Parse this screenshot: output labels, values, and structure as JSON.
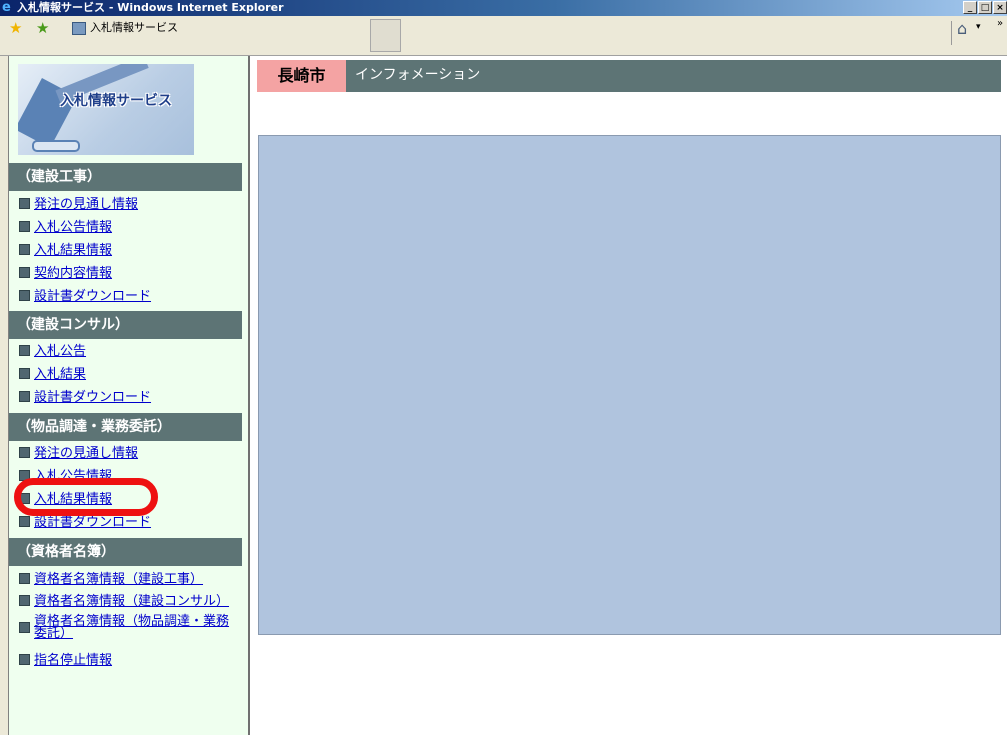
{
  "window": {
    "title": "入札情報サービス - Windows Internet Explorer",
    "min_label": "_",
    "max_label": "□",
    "close_label": "×"
  },
  "toolbar": {
    "tab_title": "入札情報サービス",
    "home_dropdown": "▾",
    "more_label": "»"
  },
  "logo": {
    "text": "入札情報サービス"
  },
  "sections": [
    {
      "header": "（建設工事）",
      "items": [
        "発注の見通し情報",
        "入札公告情報",
        "入札結果情報",
        "契約内容情報",
        "設計書ダウンロード"
      ]
    },
    {
      "header": "（建設コンサル）",
      "items": [
        "入札公告",
        "入札結果",
        "設計書ダウンロード"
      ]
    },
    {
      "header": "（物品調達・業務委託）",
      "items": [
        "発注の見通し情報",
        "入札公告情報",
        "入札結果情報",
        "設計書ダウンロード"
      ]
    },
    {
      "header": "（資格者名簿）",
      "items": [
        "資格者名簿情報（建設工事）",
        "資格者名簿情報（建設コンサル）",
        "資格者名簿情報（物品調達・業務委託）",
        "指名停止情報"
      ]
    }
  ],
  "main": {
    "city": "長崎市",
    "info_label": "インフォメーション"
  },
  "colors": {
    "section_header_bg": "#5d7475",
    "sidebar_bg": "#efffef",
    "city_badge_bg": "#f4a3a3",
    "info_panel_bg": "#b0c4de",
    "link_color": "#0000cc",
    "highlight_ring": "#ee1111"
  }
}
